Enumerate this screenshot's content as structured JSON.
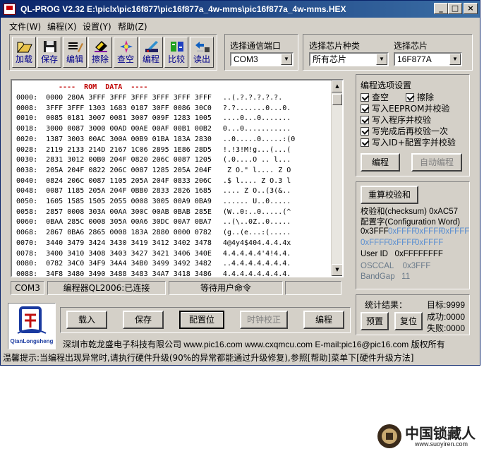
{
  "window": {
    "title": "QL-PROG V2.32  E:\\piclx\\pic16f877\\pic16f877a_4w-mms\\pic16f877a_4w-mms.HEX",
    "minimize": "_",
    "maximize": "□",
    "close": "×"
  },
  "menu": [
    {
      "label": "文件(W)"
    },
    {
      "label": "编程(X)"
    },
    {
      "label": "设置(Y)"
    },
    {
      "label": "帮助(Z)"
    }
  ],
  "toolbar": [
    {
      "label": "加载",
      "icon": "load-icon"
    },
    {
      "label": "保存",
      "icon": "save-icon"
    },
    {
      "label": "编辑",
      "icon": "edit-icon"
    },
    {
      "label": "擦除",
      "icon": "erase-icon"
    },
    {
      "label": "查空",
      "icon": "blank-check-icon"
    },
    {
      "label": "编程",
      "icon": "program-icon"
    },
    {
      "label": "比较",
      "icon": "compare-icon"
    },
    {
      "label": "读出",
      "icon": "read-icon"
    }
  ],
  "port": {
    "label": "选择通信端口",
    "value": "COM3"
  },
  "chip_type": {
    "label": "选择芯片种类",
    "value": "所有芯片"
  },
  "chip": {
    "label": "选择芯片",
    "value": "16F877A"
  },
  "hex": {
    "header": "----  ROM  DATA  ----",
    "rows": [
      {
        "addr": "0000:",
        "data": "0000 280A 3FFF 3FFF 3FFF 3FFF 3FFF 3FFF",
        "ascii": "..(.?.?.?.?.?."
      },
      {
        "addr": "0008:",
        "data": "3FFF 3FFF 1303 1683 0187 30FF 0086 30C0",
        "ascii": "?.?.......0...0."
      },
      {
        "addr": "0010:",
        "data": "0085 0181 3007 0081 3007 009F 1283 1005",
        "ascii": "....0...0......."
      },
      {
        "addr": "0018:",
        "data": "3000 0087 3000 00AD 00AE 00AF 00B1 00B2",
        "ascii": "0...0..........."
      },
      {
        "addr": "0020:",
        "data": "1387 3003 00AC 300A 00B9 01BA 183A 2830",
        "ascii": "..0.....0.....:(0"
      },
      {
        "addr": "0028:",
        "data": "2119 2133 214D 2167 1C06 2895 1E86 28D5",
        "ascii": "!.!3!M!g...(...("
      },
      {
        "addr": "0030:",
        "data": "2831 3012 00B0 204F 0820 206C 0087 1205",
        "ascii": "(.0....O .. l..."
      },
      {
        "addr": "0038:",
        "data": "205A 204F 0822 206C 0087 1285 205A 204F",
        "ascii": " Z O.\" l.... Z O"
      },
      {
        "addr": "0040:",
        "data": "0824 206C 0087 1105 205A 204F 0833 206C",
        "ascii": ".$ l.... Z O.3 l"
      },
      {
        "addr": "0048:",
        "data": "0087 1185 205A 204F 0BB0 2833 2826 1685",
        "ascii": ".... Z O..(3(&.."
      },
      {
        "addr": "0050:",
        "data": "1605 1585 1505 2055 0008 3005 00A9 0BA9",
        "ascii": "...... U..0....."
      },
      {
        "addr": "0058:",
        "data": "2857 0008 303A 00AA 300C 00AB 0BAB 285E",
        "ascii": "(W..0:..0.....(^"
      },
      {
        "addr": "0060:",
        "data": "0BAA 285C 0008 305A 00A6 30DC 00A7 0BA7",
        "ascii": "..(\\..0Z..0....."
      },
      {
        "addr": "0068:",
        "data": "2867 0BA6 2865 0008 183A 2880 0000 0782",
        "ascii": "(g..(e...:(....."
      },
      {
        "addr": "0070:",
        "data": "3440 3479 3424 3430 3419 3412 3402 3478",
        "ascii": "4@4y4$404.4.4.4x"
      },
      {
        "addr": "0078:",
        "data": "3400 3410 3408 3403 3427 3421 3406 340E",
        "ascii": "4.4.4.4.4'4!4.4."
      },
      {
        "addr": "0080:",
        "data": "0782 34C0 34F9 34A4 34B0 3499 3492 3482",
        "ascii": "..4.4.4.4.4.4.4."
      },
      {
        "addr": "0088:",
        "data": "34F8 3480 3490 3488 3483 34A7 3418 3486",
        "ascii": "4.4.4.4.4.4.4.4."
      }
    ]
  },
  "status": {
    "port": "COM3",
    "programmer": "编程器QL2006:已连接",
    "state": "等待用户命令",
    "extra": ""
  },
  "options": {
    "title": "编程选项设置",
    "items": [
      {
        "label": "查空"
      },
      {
        "label": "擦除"
      },
      {
        "label": "写入EEPROM并校验"
      },
      {
        "label": "写入程序并校验"
      },
      {
        "label": "写完成后再校验一次"
      },
      {
        "label": "写入ID+配置字并校验"
      }
    ],
    "program_btn": "编程",
    "auto_program_btn": "自动编程"
  },
  "checksum": {
    "recalc_btn": "重算校验和",
    "checksum_line": "校验和(checksum) 0xAC57",
    "config_label": "配置字(Configuration Word)",
    "config_values": [
      "0x3FFF",
      "0xFFFF",
      "0xFFFF",
      "0xFFFF"
    ],
    "config_values2": [
      "0xFFFF",
      "0xFFFF",
      "0xFFFF"
    ],
    "user_id": "User ID   0xFFFFFFFF",
    "osccal": "OSCCAL    0x3FFF",
    "bandgap": "BandGap   11"
  },
  "actions": {
    "load": "载入",
    "save": "保存",
    "config": "配置位",
    "clock": "时钟校正",
    "program": "编程"
  },
  "stats": {
    "title": "统计结果：",
    "target": "目标:9999",
    "success": "成功:0000",
    "fail": "失败:0000",
    "preset_btn": "预置",
    "reset_btn": "复位"
  },
  "logo": {
    "text": "QianLongsheng"
  },
  "company": "深圳市乾龙盛电子科技有限公司 www.pic16.com www.cxqmcu.com E-mail:pic16@pic16.com 版权所有",
  "note": "温馨提示:当编程出现异常时,请执行硬件升级(90%的异常都能通过升级修复),参照[帮助]菜单下[硬件升级方法]",
  "watermark": {
    "cn": "中国锁藏人",
    "url": "www.suoyiren.com"
  },
  "colors": {
    "title_bar": "#0a246a",
    "face": "#d4d0c8",
    "hex_header": "#c00000"
  }
}
